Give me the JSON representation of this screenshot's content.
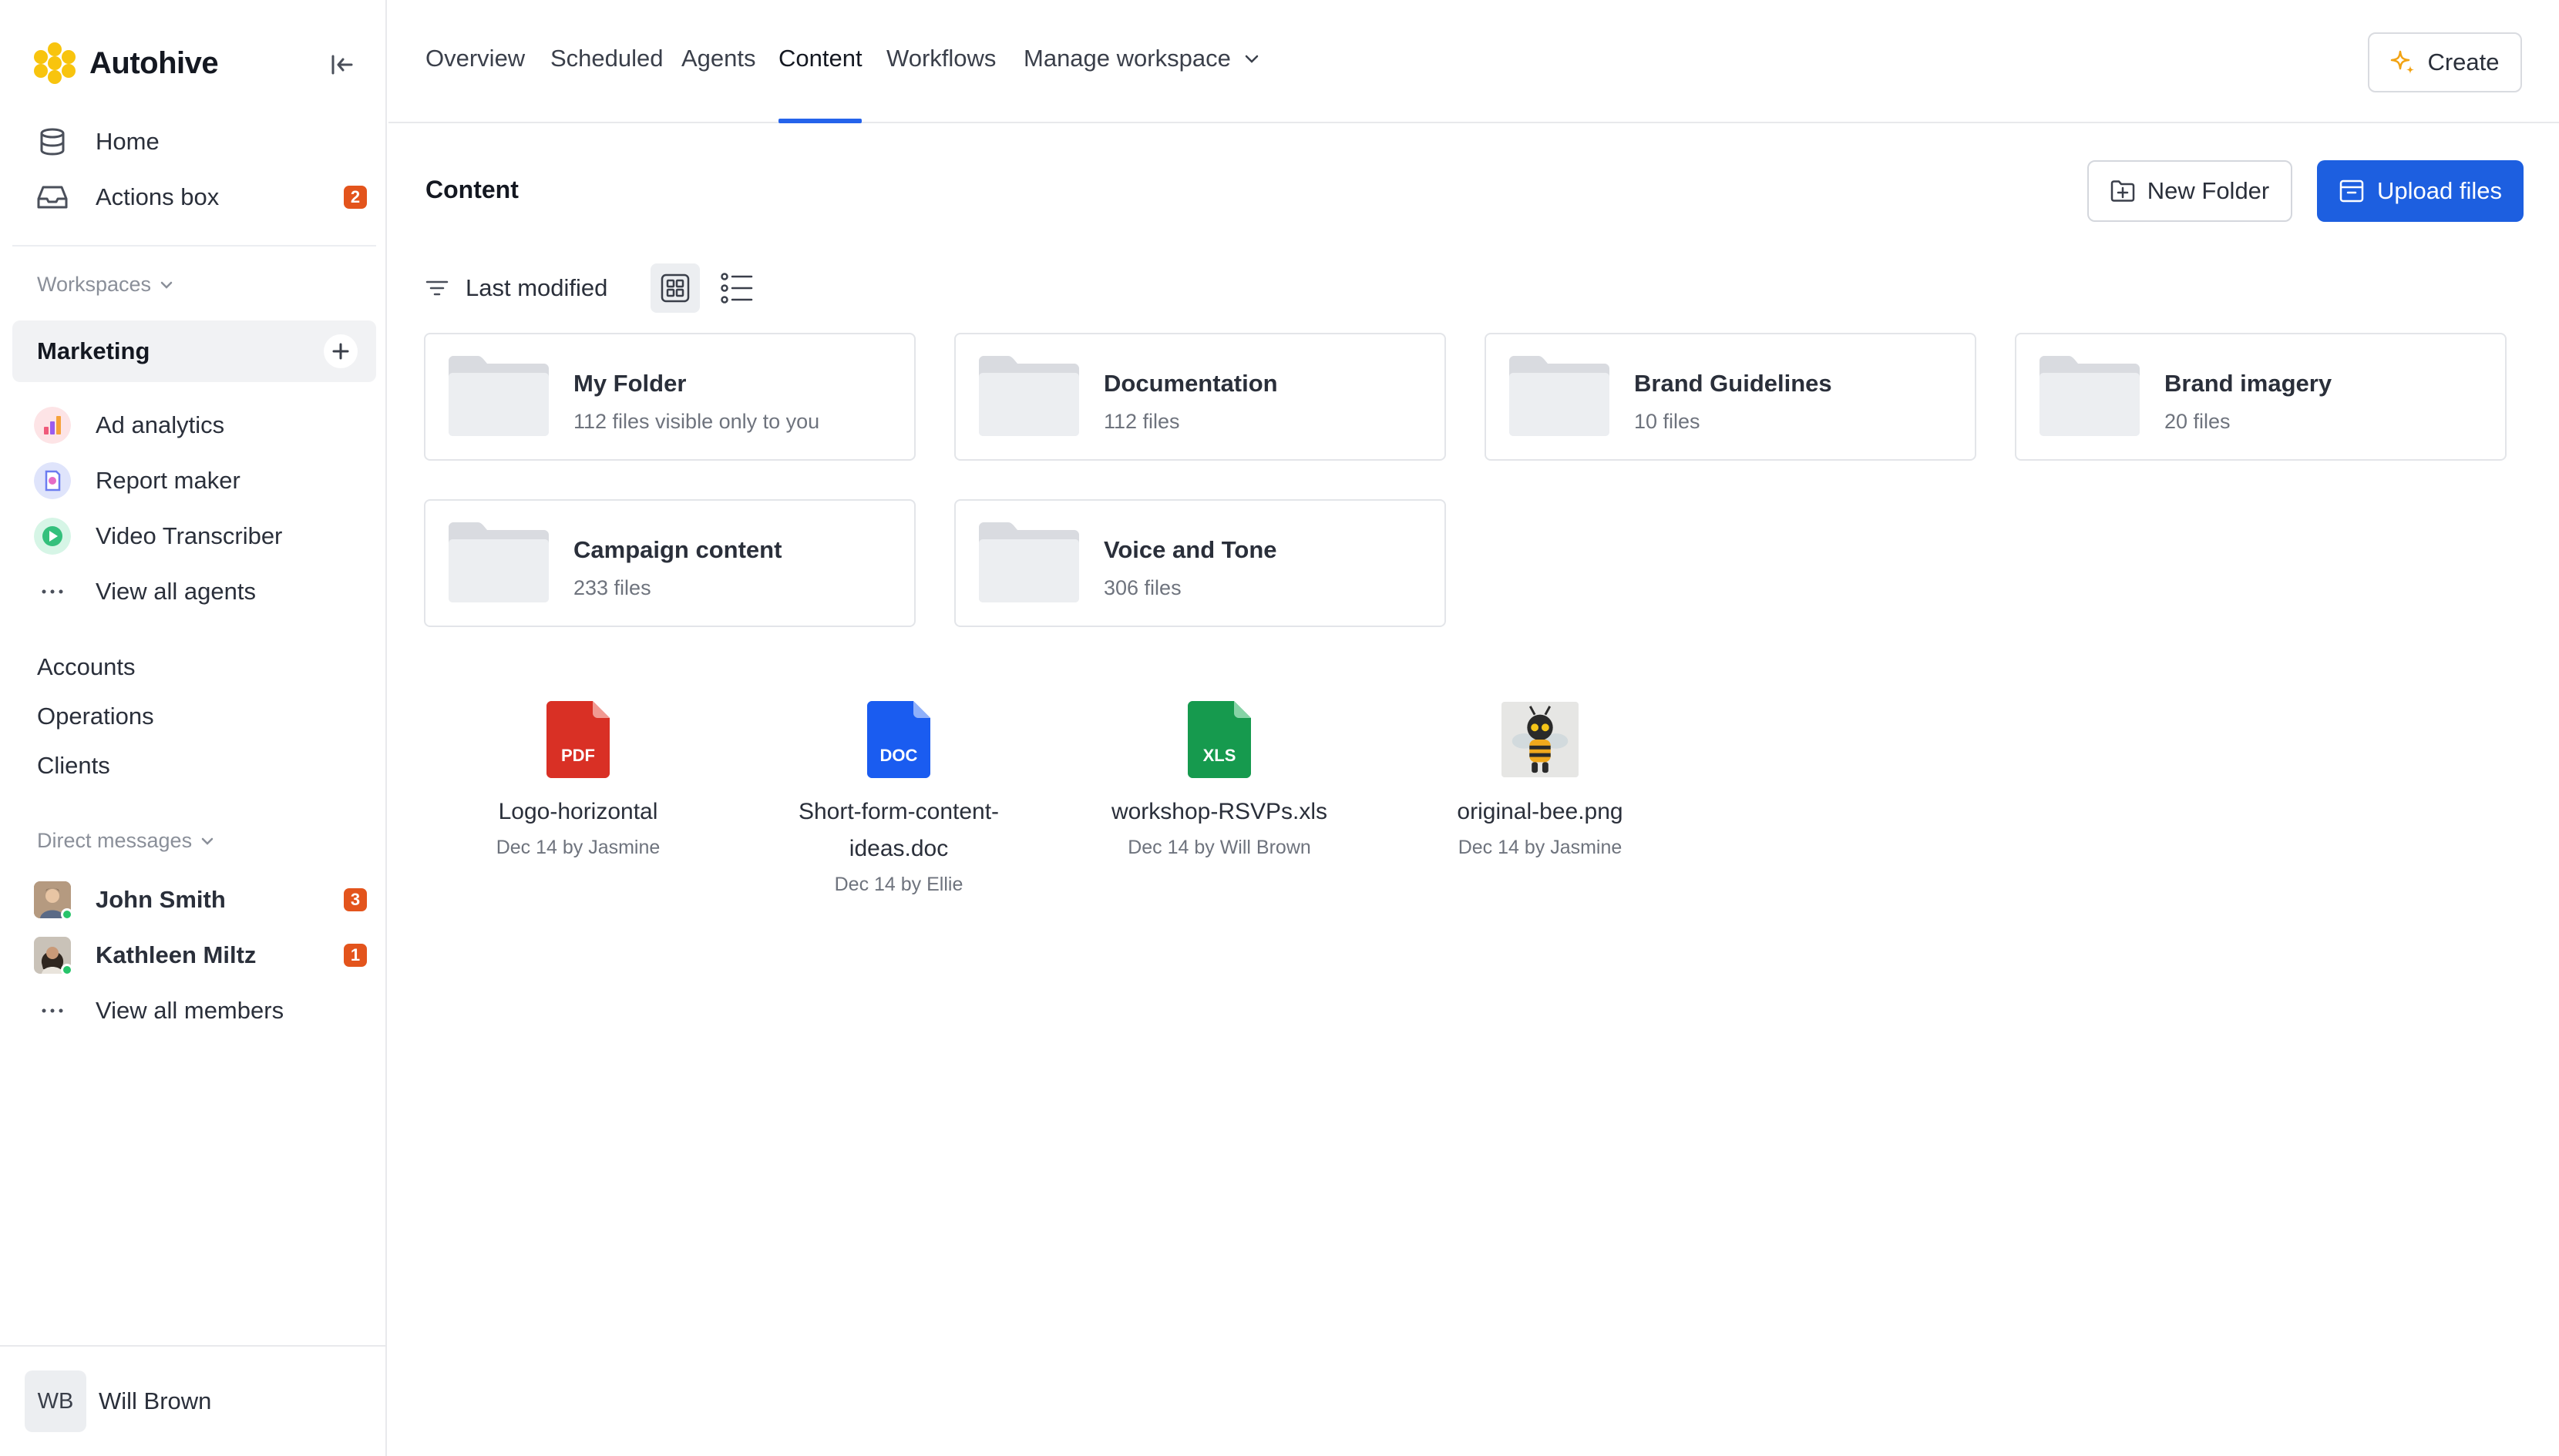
{
  "app": {
    "name": "Autohive"
  },
  "sidebar": {
    "nav": [
      {
        "label": "Home",
        "icon": "database-icon"
      },
      {
        "label": "Actions box",
        "icon": "inbox-icon",
        "badge": "2"
      }
    ],
    "workspaces_label": "Workspaces",
    "active_workspace": "Marketing",
    "agents": [
      {
        "label": "Ad analytics",
        "icon": "ad-analytics-icon"
      },
      {
        "label": "Report maker",
        "icon": "report-maker-icon"
      },
      {
        "label": "Video Transcriber",
        "icon": "video-transcriber-icon"
      }
    ],
    "view_all_agents": "View all agents",
    "other_workspaces": [
      "Accounts",
      "Operations",
      "Clients"
    ],
    "direct_messages_label": "Direct messages",
    "members": [
      {
        "name": "John Smith",
        "badge": "3"
      },
      {
        "name": "Kathleen Miltz",
        "badge": "1"
      }
    ],
    "view_all_members": "View all members",
    "user": {
      "initials": "WB",
      "name": "Will Brown"
    }
  },
  "topnav": {
    "tabs": [
      "Overview",
      "Scheduled",
      "Agents",
      "Content",
      "Workflows",
      "Manage workspace"
    ],
    "active_tab": "Content",
    "create_label": "Create"
  },
  "content": {
    "title": "Content",
    "new_folder_label": "New Folder",
    "upload_label": "Upload files",
    "sort_label": "Last modified",
    "folders": [
      {
        "name": "My Folder",
        "subtitle": "112 files visible only to you"
      },
      {
        "name": "Documentation",
        "subtitle": "112 files"
      },
      {
        "name": "Brand Guidelines",
        "subtitle": "10 files"
      },
      {
        "name": "Brand imagery",
        "subtitle": "20 files"
      },
      {
        "name": "Campaign content",
        "subtitle": "233 files"
      },
      {
        "name": "Voice and Tone",
        "subtitle": "306 files"
      }
    ],
    "files": [
      {
        "name": "Logo-horizontal",
        "meta": "Dec 14 by Jasmine",
        "type": "PDF",
        "color": "#d93025"
      },
      {
        "name_line1": "Short-form-content-",
        "name_line2": "ideas.doc",
        "meta": "Dec 14 by Ellie",
        "type": "DOC",
        "color": "#1a5cf0"
      },
      {
        "name": "workshop-RSVPs.xls",
        "meta": "Dec 14 by Will Brown",
        "type": "XLS",
        "color": "#169a4e"
      },
      {
        "name": "original-bee.png",
        "meta": "Dec 14 by Jasmine",
        "type": "PNG"
      }
    ]
  },
  "colors": {
    "accent": "#1d5fe0",
    "badge": "#e3541c",
    "brand": "#f8c40e"
  }
}
